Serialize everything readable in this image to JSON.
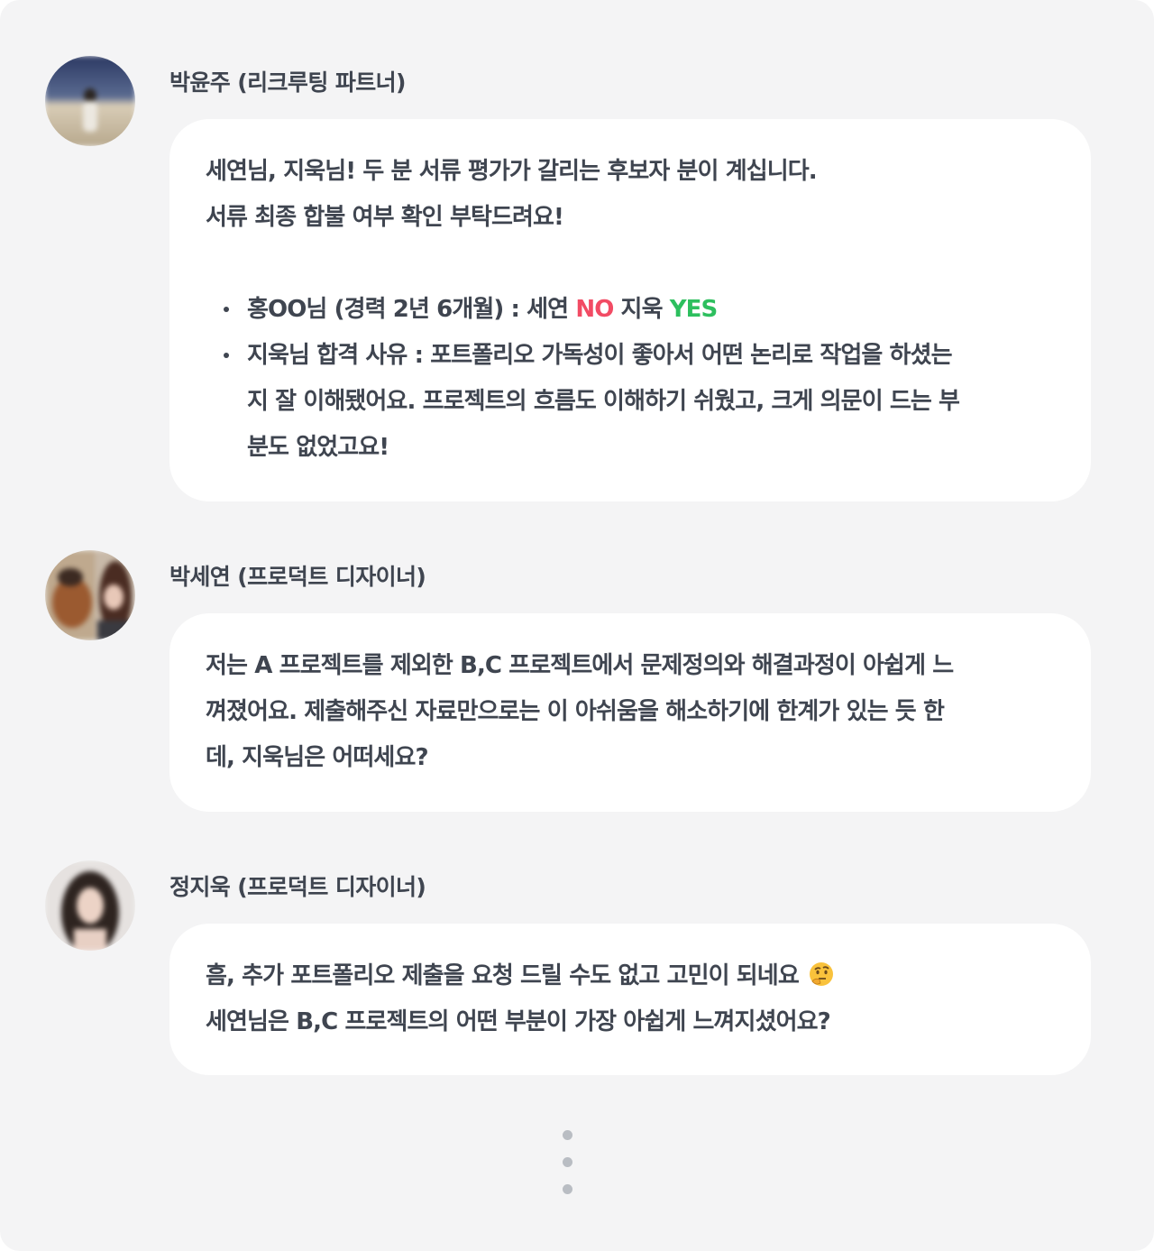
{
  "messages": [
    {
      "author": "박윤주 (리크루팅 파트너)",
      "lines": [
        "세연님, 지욱님! 두 분 서류 평가가 갈리는 후보자 분이 계십니다.",
        "서류 최종 합불 여부 확인 부탁드려요!"
      ],
      "bullet1": {
        "prefix": "홍OO님 (경력 2년 6개월) : 세연 ",
        "no": "NO",
        "middle": " 지욱 ",
        "yes": "YES"
      },
      "bullet2_lines": [
        "지욱님 합격 사유 : 포트폴리오 가독성이 좋아서 어떤 논리로 작업을 하셨는",
        "지 잘 이해됐어요. 프로젝트의 흐름도 이해하기 쉬웠고, 크게 의문이 드는 부",
        "분도 없었고요!"
      ]
    },
    {
      "author": "박세연 (프로덕트 디자이너)",
      "lines": [
        "저는 A 프로젝트를 제외한 B,C 프로젝트에서 문제정의와 해결과정이 아쉽게 느",
        "껴졌어요. 제출해주신 자료만으로는 이 아쉬움을 해소하기에 한계가 있는 듯 한",
        "데, 지욱님은 어떠세요?"
      ]
    },
    {
      "author": "정지욱 (프로덕트 디자이너)",
      "lines": [
        "흠, 추가 포트폴리오 제출을 요청 드릴 수도 없고 고민이 되네요",
        "세연님은 B,C 프로젝트의 어떤 부분이 가장 아쉽게 느껴지셨어요?"
      ],
      "emoji": "thinking-face-icon"
    }
  ],
  "colors": {
    "background": "#f4f4f5",
    "bubble": "#ffffff",
    "text": "#3f4550",
    "no": "#f24b64",
    "yes": "#2dbf5e"
  },
  "more_indicator": "vertical-ellipsis-icon"
}
